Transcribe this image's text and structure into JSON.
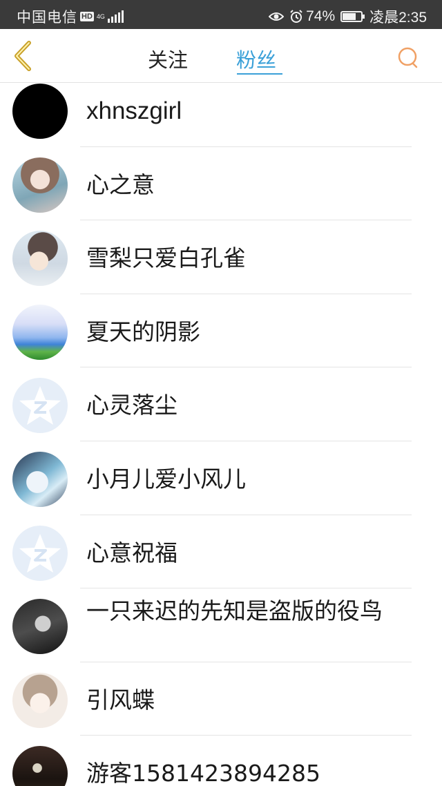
{
  "status_bar": {
    "carrier": "中国电信",
    "hd_badge": "HD",
    "network_type": "4G",
    "battery_percent": "74%",
    "battery_level": 0.74,
    "time": "凌晨2:35",
    "icons": [
      "signal-icon",
      "eye-icon",
      "alarm-icon",
      "battery-icon"
    ]
  },
  "header": {
    "back_icon": "chevron-left-icon",
    "tabs": [
      {
        "label": "关注",
        "active": false
      },
      {
        "label": "粉丝",
        "active": true
      }
    ],
    "search_icon": "search-icon",
    "accent_color": "#3aa0d8",
    "back_color": "#c9a12a",
    "search_color": "#f0a064"
  },
  "fans": [
    {
      "name": "xhnszgirl",
      "avatar": "black"
    },
    {
      "name": "心之意",
      "avatar": "anime-girl-blue"
    },
    {
      "name": "雪梨只爱白孔雀",
      "avatar": "anime-girl-hat"
    },
    {
      "name": "夏天的阴影",
      "avatar": "castle-scene"
    },
    {
      "name": "心灵落尘",
      "avatar": "default-qq-star"
    },
    {
      "name": "小月儿爱小风儿",
      "avatar": "anime-girl-ice"
    },
    {
      "name": "心意祝福",
      "avatar": "default-qq-star"
    },
    {
      "name": "一只来迟的先知是盗版的役鸟",
      "avatar": "dark-hat-figure"
    },
    {
      "name": "引风蝶",
      "avatar": "anime-girl-bow"
    },
    {
      "name": "游客1581423894285",
      "avatar": "night-forest-moon"
    }
  ]
}
